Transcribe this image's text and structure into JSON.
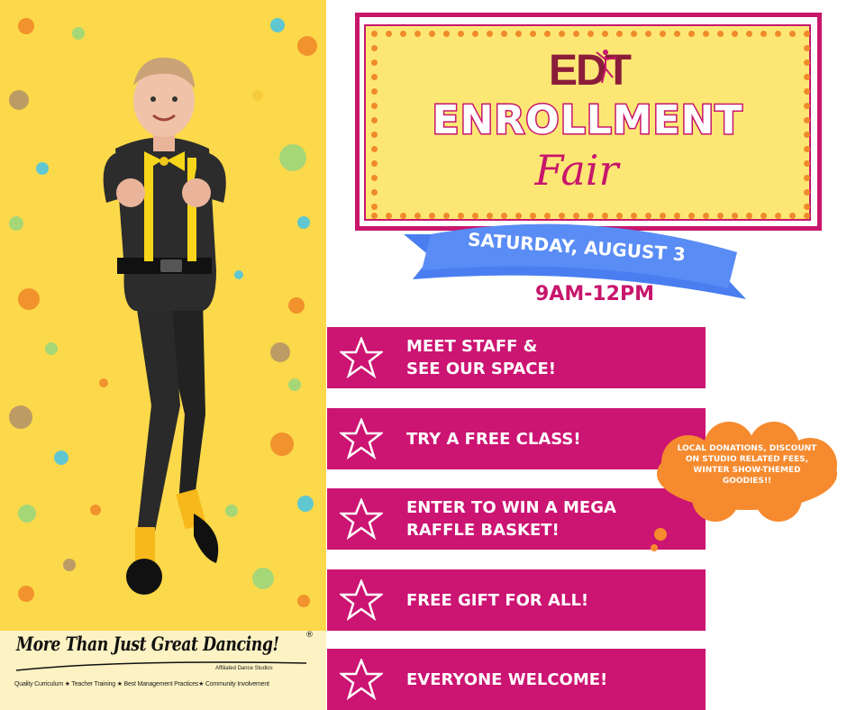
{
  "brand": {
    "name": "More Than Just Great Dancing!",
    "registered": "®",
    "sub": "Affiliated Dance Studios",
    "tagline": "Quality Curriculum ★ Teacher Training ★ Best Management Practices★ Community Involvement"
  },
  "event": {
    "logo": "EDT",
    "title": "ENROLLMENT",
    "subtitle": "Fair",
    "date": "SATURDAY, AUGUST 3",
    "time": "9AM-12PM"
  },
  "features": [
    {
      "label": "MEET STAFF &\nSEE OUR SPACE!"
    },
    {
      "label": "TRY A FREE CLASS!"
    },
    {
      "label": "ENTER TO WIN A MEGA\nRAFFLE BASKET!"
    },
    {
      "label": "FREE GIFT FOR ALL!"
    },
    {
      "label": "EVERYONE WELCOME!"
    }
  ],
  "callout": {
    "text": "LOCAL DONATIONS, DISCOUNT ON STUDIO RELATED FEES, WINTER SHOW-THEMED GOODIES!!"
  },
  "colors": {
    "magenta": "#cc1472",
    "yellow": "#fcd94a",
    "blue": "#4a7ef0",
    "orange": "#f68a2e"
  },
  "icons": [
    "star-icon",
    "dancer-icon"
  ]
}
